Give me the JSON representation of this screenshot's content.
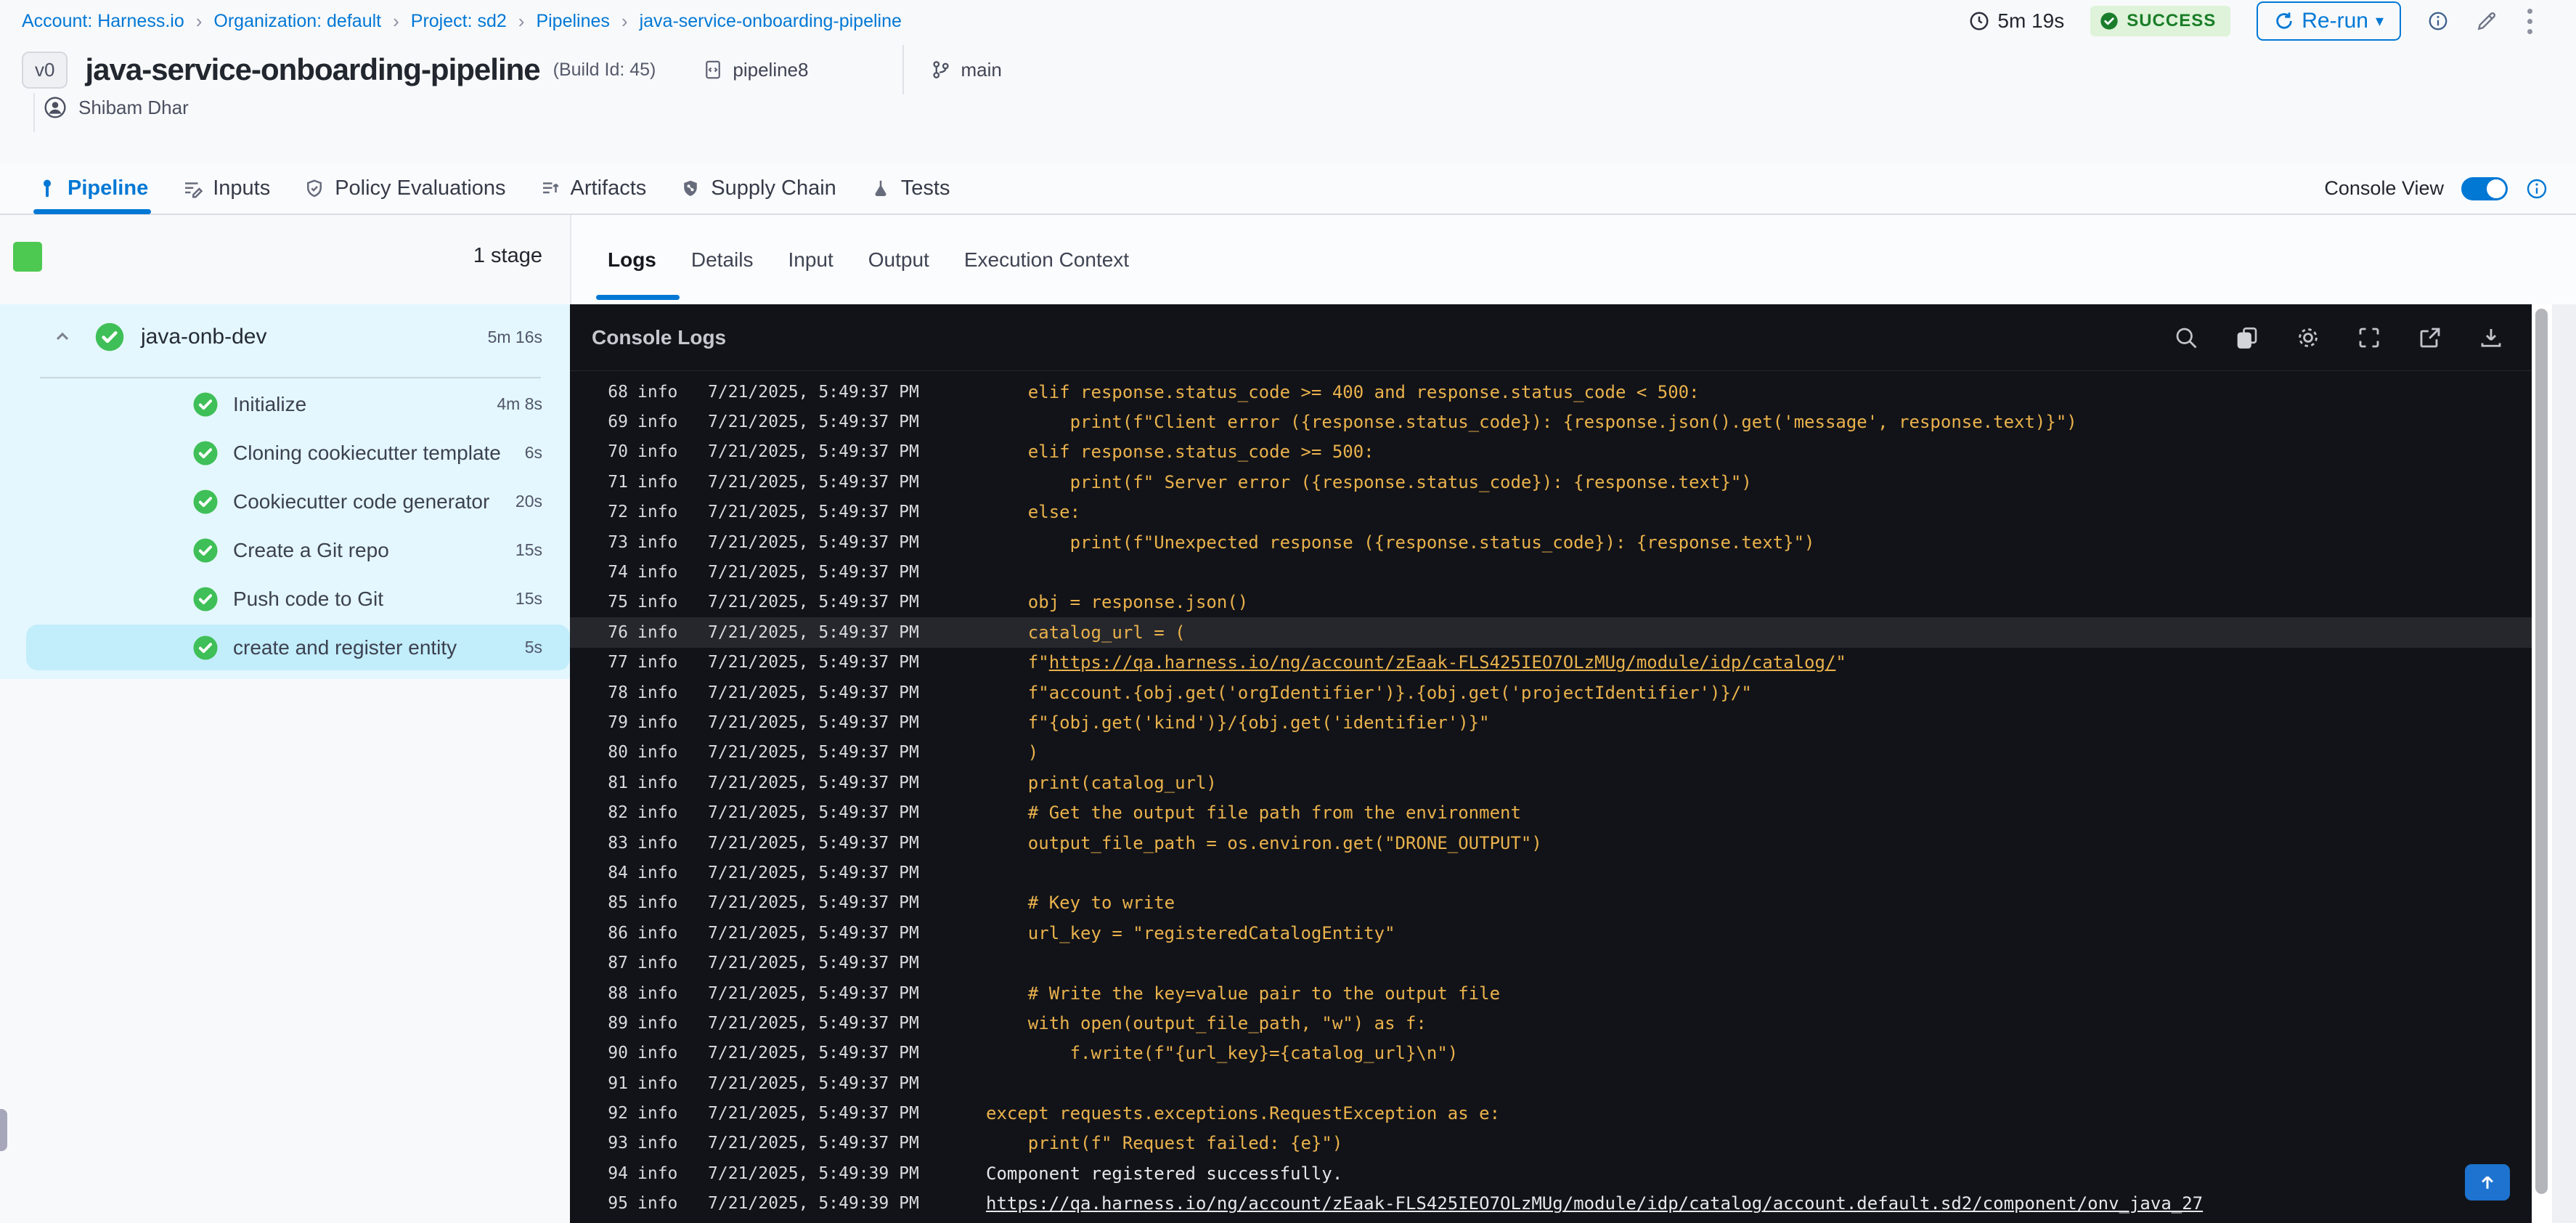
{
  "breadcrumb": {
    "separator": "›",
    "items": [
      "Account: Harness.io",
      "Organization: default",
      "Project: sd2",
      "Pipelines",
      "java-service-onboarding-pipeline"
    ]
  },
  "topbar": {
    "duration": "5m 19s",
    "status": "SUCCESS",
    "rerun_label": "Re-run"
  },
  "title": {
    "version_badge": "v0",
    "name": "java-service-onboarding-pipeline",
    "build": "(Build Id: 45)",
    "pipeline_ref": "pipeline8",
    "branch": "main",
    "author": "Shibam Dhar"
  },
  "nav_tabs": {
    "items": [
      {
        "label": "Pipeline",
        "active": true
      },
      {
        "label": "Inputs",
        "active": false
      },
      {
        "label": "Policy Evaluations",
        "active": false
      },
      {
        "label": "Artifacts",
        "active": false
      },
      {
        "label": "Supply Chain",
        "active": false
      },
      {
        "label": "Tests",
        "active": false
      }
    ],
    "console_view_label": "Console View"
  },
  "stage_panel": {
    "count_label": "1 stage",
    "stage": {
      "name": "java-onb-dev",
      "duration": "5m 16s"
    },
    "steps": [
      {
        "label": "Initialize",
        "duration": "4m 8s",
        "selected": false
      },
      {
        "label": "Cloning cookiecutter template",
        "duration": "6s",
        "selected": false
      },
      {
        "label": "Cookiecutter code generator",
        "duration": "20s",
        "selected": false
      },
      {
        "label": "Create a Git repo",
        "duration": "15s",
        "selected": false
      },
      {
        "label": "Push code to Git",
        "duration": "15s",
        "selected": false
      },
      {
        "label": "create and register entity",
        "duration": "5s",
        "selected": true
      }
    ]
  },
  "log_panel": {
    "tabs": [
      {
        "label": "Logs",
        "active": true
      },
      {
        "label": "Details",
        "active": false
      },
      {
        "label": "Input",
        "active": false
      },
      {
        "label": "Output",
        "active": false
      },
      {
        "label": "Execution Context",
        "active": false
      }
    ],
    "title": "Console Logs",
    "toolbar_icons": [
      "search-icon",
      "copy-icon",
      "settings-icon",
      "fullscreen-icon",
      "open-in-new-icon",
      "download-icon"
    ],
    "lines": [
      {
        "n": 68,
        "level": "info",
        "ts": "7/21/2025, 5:49:37 PM",
        "style": "code",
        "text": "    elif response.status_code >= 400 and response.status_code < 500:"
      },
      {
        "n": 69,
        "level": "info",
        "ts": "7/21/2025, 5:49:37 PM",
        "style": "code",
        "text": "        print(f\"Client error ({response.status_code}): {response.json().get('message', response.text)}\")"
      },
      {
        "n": 70,
        "level": "info",
        "ts": "7/21/2025, 5:49:37 PM",
        "style": "code",
        "text": "    elif response.status_code >= 500:"
      },
      {
        "n": 71,
        "level": "info",
        "ts": "7/21/2025, 5:49:37 PM",
        "style": "code",
        "text": "        print(f\" Server error ({response.status_code}): {response.text}\")"
      },
      {
        "n": 72,
        "level": "info",
        "ts": "7/21/2025, 5:49:37 PM",
        "style": "code",
        "text": "    else:"
      },
      {
        "n": 73,
        "level": "info",
        "ts": "7/21/2025, 5:49:37 PM",
        "style": "code",
        "text": "        print(f\"Unexpected response ({response.status_code}): {response.text}\")"
      },
      {
        "n": 74,
        "level": "info",
        "ts": "7/21/2025, 5:49:37 PM",
        "style": "code",
        "text": ""
      },
      {
        "n": 75,
        "level": "info",
        "ts": "7/21/2025, 5:49:37 PM",
        "style": "code",
        "text": "    obj = response.json()"
      },
      {
        "n": 76,
        "level": "info",
        "ts": "7/21/2025, 5:49:37 PM",
        "style": "code",
        "text": "    catalog_url = (",
        "highlight": true
      },
      {
        "n": 77,
        "level": "info",
        "ts": "7/21/2025, 5:49:37 PM",
        "style": "code",
        "text": "    f\"https://qa.harness.io/ng/account/zEaak-FLS425IEO7OLzMUg/module/idp/catalog/\"",
        "underline": "https://qa.harness.io/ng/account/zEaak-FLS425IEO7OLzMUg/module/idp/catalog/"
      },
      {
        "n": 78,
        "level": "info",
        "ts": "7/21/2025, 5:49:37 PM",
        "style": "code",
        "text": "    f\"account.{obj.get('orgIdentifier')}.{obj.get('projectIdentifier')}/\""
      },
      {
        "n": 79,
        "level": "info",
        "ts": "7/21/2025, 5:49:37 PM",
        "style": "code",
        "text": "    f\"{obj.get('kind')}/{obj.get('identifier')}\""
      },
      {
        "n": 80,
        "level": "info",
        "ts": "7/21/2025, 5:49:37 PM",
        "style": "code",
        "text": "    )"
      },
      {
        "n": 81,
        "level": "info",
        "ts": "7/21/2025, 5:49:37 PM",
        "style": "code",
        "text": "    print(catalog_url)"
      },
      {
        "n": 82,
        "level": "info",
        "ts": "7/21/2025, 5:49:37 PM",
        "style": "code",
        "text": "    # Get the output file path from the environment"
      },
      {
        "n": 83,
        "level": "info",
        "ts": "7/21/2025, 5:49:37 PM",
        "style": "code",
        "text": "    output_file_path = os.environ.get(\"DRONE_OUTPUT\")"
      },
      {
        "n": 84,
        "level": "info",
        "ts": "7/21/2025, 5:49:37 PM",
        "style": "code",
        "text": ""
      },
      {
        "n": 85,
        "level": "info",
        "ts": "7/21/2025, 5:49:37 PM",
        "style": "code",
        "text": "    # Key to write"
      },
      {
        "n": 86,
        "level": "info",
        "ts": "7/21/2025, 5:49:37 PM",
        "style": "code",
        "text": "    url_key = \"registeredCatalogEntity\""
      },
      {
        "n": 87,
        "level": "info",
        "ts": "7/21/2025, 5:49:37 PM",
        "style": "code",
        "text": ""
      },
      {
        "n": 88,
        "level": "info",
        "ts": "7/21/2025, 5:49:37 PM",
        "style": "code",
        "text": "    # Write the key=value pair to the output file"
      },
      {
        "n": 89,
        "level": "info",
        "ts": "7/21/2025, 5:49:37 PM",
        "style": "code",
        "text": "    with open(output_file_path, \"w\") as f:"
      },
      {
        "n": 90,
        "level": "info",
        "ts": "7/21/2025, 5:49:37 PM",
        "style": "code",
        "text": "        f.write(f\"{url_key}={catalog_url}\\n\")"
      },
      {
        "n": 91,
        "level": "info",
        "ts": "7/21/2025, 5:49:37 PM",
        "style": "code",
        "text": ""
      },
      {
        "n": 92,
        "level": "info",
        "ts": "7/21/2025, 5:49:37 PM",
        "style": "code",
        "text": "except requests.exceptions.RequestException as e:"
      },
      {
        "n": 93,
        "level": "info",
        "ts": "7/21/2025, 5:49:37 PM",
        "style": "code",
        "text": "    print(f\" Request failed: {e}\")"
      },
      {
        "n": 94,
        "level": "info",
        "ts": "7/21/2025, 5:49:39 PM",
        "style": "plain",
        "text": "Component registered successfully."
      },
      {
        "n": 95,
        "level": "info",
        "ts": "7/21/2025, 5:49:39 PM",
        "style": "plain",
        "text": "https://qa.harness.io/ng/account/zEaak-FLS425IEO7OLzMUg/module/idp/catalog/account.default.sd2/component/onv_java_27",
        "underline": "https://qa.harness.io/ng/account/zEaak-FLS425IEO7OLzMUg/module/idp/catalog/account.default.sd2/component/onv_java_27"
      }
    ]
  },
  "colors": {
    "accent_blue": "#0278d5",
    "success_green": "#4dc952",
    "log_gold": "#eab24c",
    "console_bg": "#121318",
    "stage_panel_bg": "#e4f7fe",
    "selected_step_bg": "#c2edfb",
    "success_badge_bg": "#def3d9",
    "success_badge_text": "#1a7d28"
  }
}
